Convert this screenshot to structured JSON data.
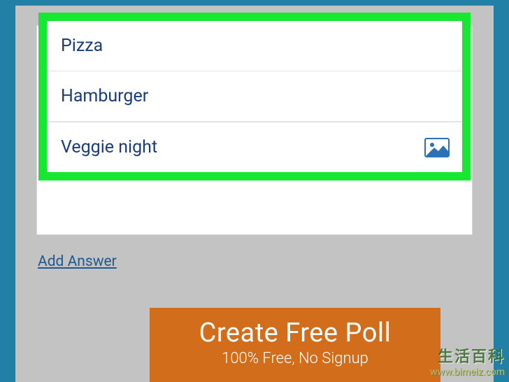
{
  "options": [
    {
      "label": "Pizza"
    },
    {
      "label": "Hamburger"
    },
    {
      "label": "Veggie night"
    }
  ],
  "add_answer_label": "Add Answer",
  "cta": {
    "title": "Create Free Poll",
    "subtitle": "100% Free, No Signup"
  },
  "watermark": {
    "text": "生活百科",
    "url": "www.bimeiz.com"
  },
  "colors": {
    "page_bg": "#2280a7",
    "card_bg": "#c3c3c3",
    "highlight_border": "#16e832",
    "cta_bg": "#d26d1b",
    "option_text": "#1a3d7a",
    "link_text": "#1f5a8f"
  }
}
